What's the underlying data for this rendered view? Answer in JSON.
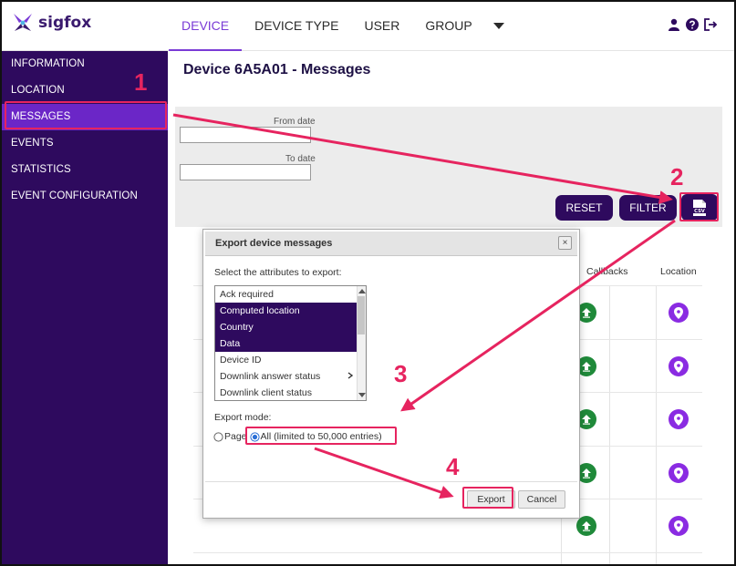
{
  "app": {
    "brand": "sigfox"
  },
  "nav": {
    "items": [
      {
        "label": "DEVICE",
        "active": true
      },
      {
        "label": "DEVICE TYPE",
        "active": false
      },
      {
        "label": "USER",
        "active": false
      },
      {
        "label": "GROUP",
        "active": false
      }
    ],
    "more_icon": "caret-down-icon",
    "right_icons": [
      "user-icon",
      "help-icon",
      "logout-icon"
    ]
  },
  "sidebar": {
    "items": [
      {
        "label": "INFORMATION"
      },
      {
        "label": "LOCATION"
      },
      {
        "label": "MESSAGES",
        "active": true
      },
      {
        "label": "EVENTS"
      },
      {
        "label": "STATISTICS"
      },
      {
        "label": "EVENT CONFIGURATION"
      }
    ]
  },
  "main": {
    "title": "Device 6A5A01 - Messages",
    "filters": {
      "from_label": "From date",
      "from_value": "",
      "to_label": "To date",
      "to_value": "",
      "reset_label": "RESET",
      "filter_label": "FILTER",
      "csv_label": "CSV"
    },
    "table": {
      "columns": [
        "Callbacks",
        "Location"
      ],
      "row_icons": [
        "upload-icon",
        "location-pin-icon"
      ]
    }
  },
  "dialog": {
    "title": "Export device messages",
    "close_label": "×",
    "attributes_label": "Select the attributes to export:",
    "attributes": [
      {
        "label": "Ack required",
        "selected": false
      },
      {
        "label": "Computed location",
        "selected": true
      },
      {
        "label": "Country",
        "selected": true
      },
      {
        "label": "Data",
        "selected": true
      },
      {
        "label": "Device ID",
        "selected": false
      },
      {
        "label": "Downlink answer status",
        "selected": false
      },
      {
        "label": "Downlink client status",
        "selected": false
      }
    ],
    "export_mode_label": "Export mode:",
    "mode_page": "Page",
    "mode_all": "All (limited to 50,000 entries)",
    "export_label": "Export",
    "cancel_label": "Cancel"
  },
  "annotations": {
    "steps": [
      "1",
      "2",
      "3",
      "4"
    ],
    "highlight_color": "#e6245f"
  },
  "colors": {
    "brand_dark": "#2e0a5e",
    "brand_active": "#6b26c7",
    "nav_active": "#7a3bd6",
    "callback_green": "#1f8a3a",
    "location_purple": "#8a2be2"
  }
}
